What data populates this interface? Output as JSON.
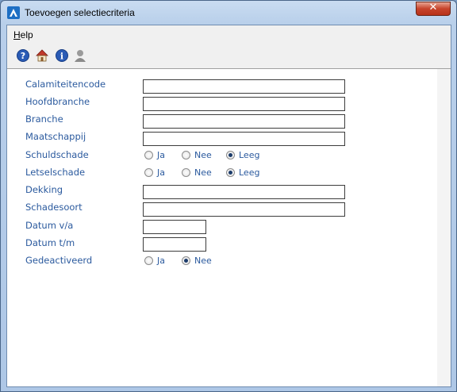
{
  "window": {
    "title": "Toevoegen selectiecriteria",
    "close_label": "✕"
  },
  "menu": {
    "help_underlined": "H",
    "help_rest": "elp"
  },
  "toolbar": {
    "icons": [
      "help-icon",
      "home-icon",
      "info-icon",
      "user-icon"
    ]
  },
  "form": {
    "calamiteitencode": {
      "label": "Calamiteitencode",
      "value": ""
    },
    "hoofdbranche": {
      "label": "Hoofdbranche",
      "value": ""
    },
    "branche": {
      "label": "Branche",
      "value": ""
    },
    "maatschappij": {
      "label": "Maatschappij",
      "value": ""
    },
    "schuldschade": {
      "label": "Schuldschade",
      "options": [
        "Ja",
        "Nee",
        "Leeg"
      ],
      "selected": "Leeg"
    },
    "letselschade": {
      "label": "Letselschade",
      "options": [
        "Ja",
        "Nee",
        "Leeg"
      ],
      "selected": "Leeg"
    },
    "dekking": {
      "label": "Dekking",
      "value": ""
    },
    "schadesoort": {
      "label": "Schadesoort",
      "value": ""
    },
    "datum_va": {
      "label": "Datum v/a",
      "value": ""
    },
    "datum_tm": {
      "label": "Datum t/m",
      "value": ""
    },
    "gedeactiveerd": {
      "label": "Gedeactiveerd",
      "options": [
        "Ja",
        "Nee"
      ],
      "selected": "Nee"
    }
  },
  "colors": {
    "label": "#2b5a9e",
    "titlebar": "#b8cfea",
    "close": "#c7432b"
  }
}
